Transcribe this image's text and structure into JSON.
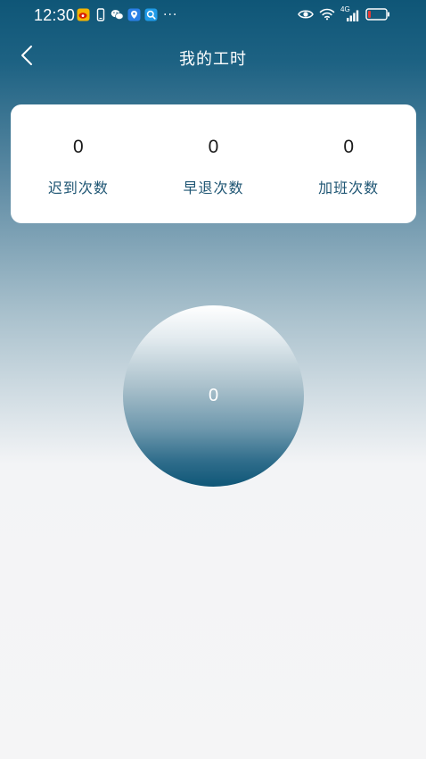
{
  "status_bar": {
    "time": "12:30",
    "more": "···",
    "network_label": "4G"
  },
  "nav": {
    "title": "我的工时"
  },
  "stats": [
    {
      "value": "0",
      "label": "迟到次数"
    },
    {
      "value": "0",
      "label": "早退次数"
    },
    {
      "value": "0",
      "label": "加班次数"
    }
  ],
  "hours": {
    "value": "0"
  },
  "colors": {
    "header_dark": "#0f5677",
    "label_blue": "#1e5573",
    "card_bg": "#ffffff",
    "page_bg": "#f5f5f6"
  },
  "icons": {
    "notification": [
      "weibo-icon",
      "phone-icon",
      "wechat-icon",
      "location-icon",
      "search-app-icon"
    ],
    "system": [
      "eye-icon",
      "wifi-icon",
      "signal-icon",
      "battery-icon"
    ],
    "nav_back": "chevron-left-icon"
  }
}
